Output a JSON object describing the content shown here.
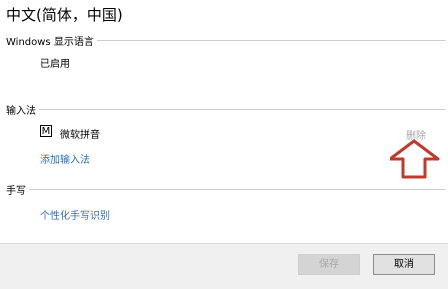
{
  "page": {
    "title": "中文(简体，中国)"
  },
  "sections": {
    "display_language": {
      "header": "Windows 显示语言",
      "status": "已启用"
    },
    "input_method": {
      "header": "输入法",
      "ime_badge": "M",
      "ime_name": "微软拼音",
      "remove_label": "删除",
      "add_link": "添加输入法"
    },
    "handwriting": {
      "header": "手写",
      "personalize_link": "个性化手写识别"
    }
  },
  "footer": {
    "save_label": "保存",
    "cancel_label": "取消"
  },
  "annotation": {
    "arrow_icon": "up-arrow-icon",
    "arrow_color": "#c0392b"
  },
  "colors": {
    "link": "#2b6fc2",
    "disabled_text": "#a8a8a8"
  }
}
